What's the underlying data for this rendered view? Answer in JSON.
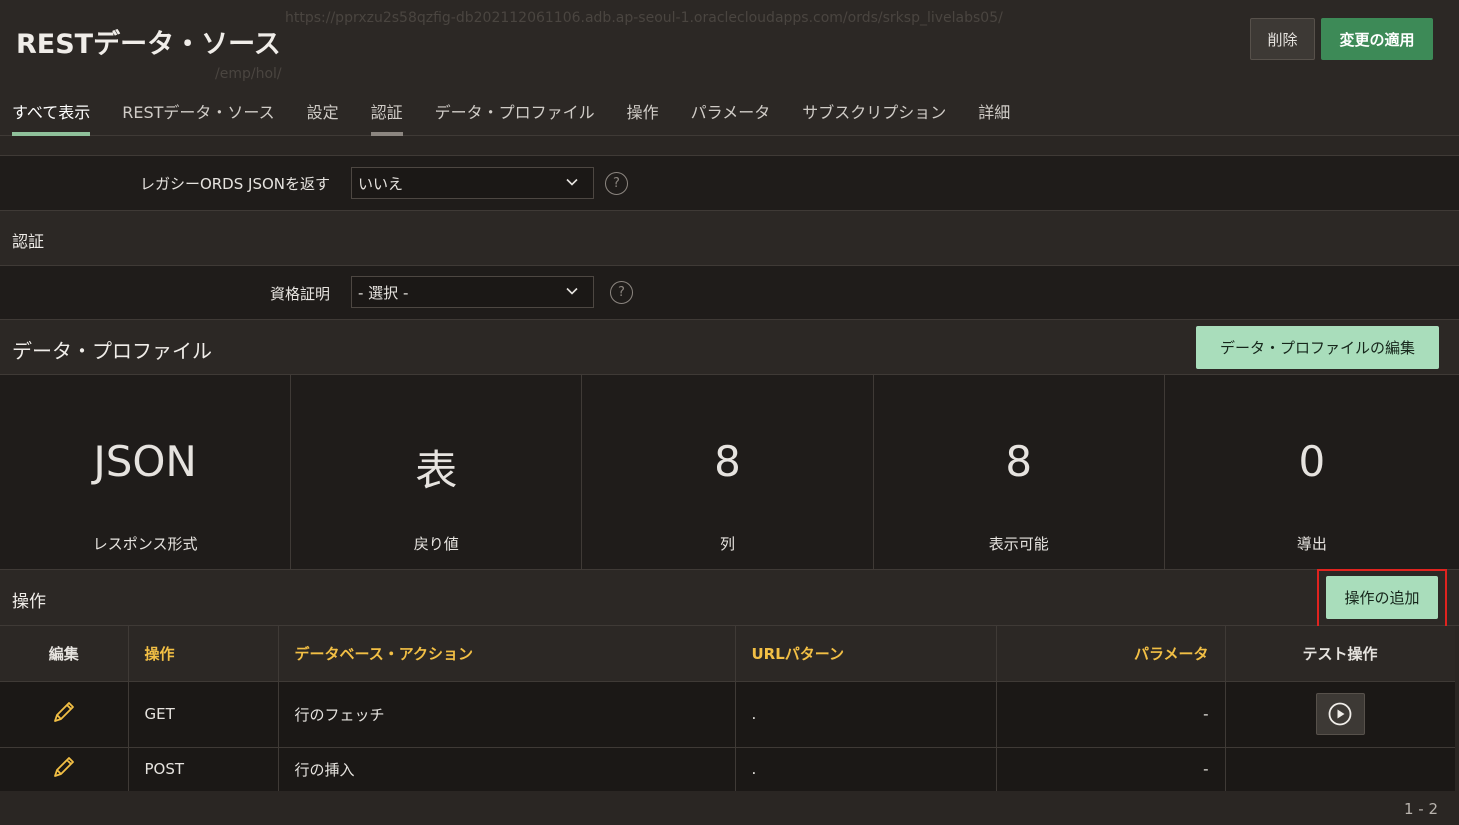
{
  "header": {
    "title": "RESTデータ・ソース",
    "ghost_url": "https://pprxzu2s58qzfig-db202112061106.adb.ap-seoul-1.oraclecloudapps.com/ords/srksp_livelabs05/",
    "ghost_path": "/emp/hol/",
    "delete_label": "削除",
    "apply_label": "変更の適用"
  },
  "tabs": [
    "すべて表示",
    "RESTデータ・ソース",
    "設定",
    "認証",
    "データ・プロファイル",
    "操作",
    "パラメータ",
    "サブスクリプション",
    "詳細"
  ],
  "legacy": {
    "label": "レガシーORDS JSONを返す",
    "value": "いいえ"
  },
  "auth": {
    "heading": "認証",
    "label": "資格証明",
    "value": "- 選択 -"
  },
  "data_profile": {
    "heading": "データ・プロファイル",
    "edit_label": "データ・プロファイルの編集",
    "stats": [
      {
        "value": "JSON",
        "label": "レスポンス形式"
      },
      {
        "value": "表",
        "label": "戻り値"
      },
      {
        "value": "8",
        "label": "列"
      },
      {
        "value": "8",
        "label": "表示可能"
      },
      {
        "value": "0",
        "label": "導出"
      }
    ]
  },
  "operations": {
    "heading": "操作",
    "add_label": "操作の追加",
    "columns": [
      "編集",
      "操作",
      "データベース・アクション",
      "URLパターン",
      "パラメータ",
      "テスト操作"
    ],
    "rows": [
      {
        "op": "GET",
        "action": "行のフェッチ",
        "url": ".",
        "params": "-"
      },
      {
        "op": "POST",
        "action": "行の挿入",
        "url": ".",
        "params": "-"
      }
    ],
    "pagination": "1 - 2"
  },
  "help_glyph": "?",
  "colors": {
    "accent_green": "#3d8a57",
    "light_green": "#a9ddbb",
    "sort_header": "#f2bf45",
    "pencil": "#f2bf45",
    "highlight": "#e0231f"
  }
}
